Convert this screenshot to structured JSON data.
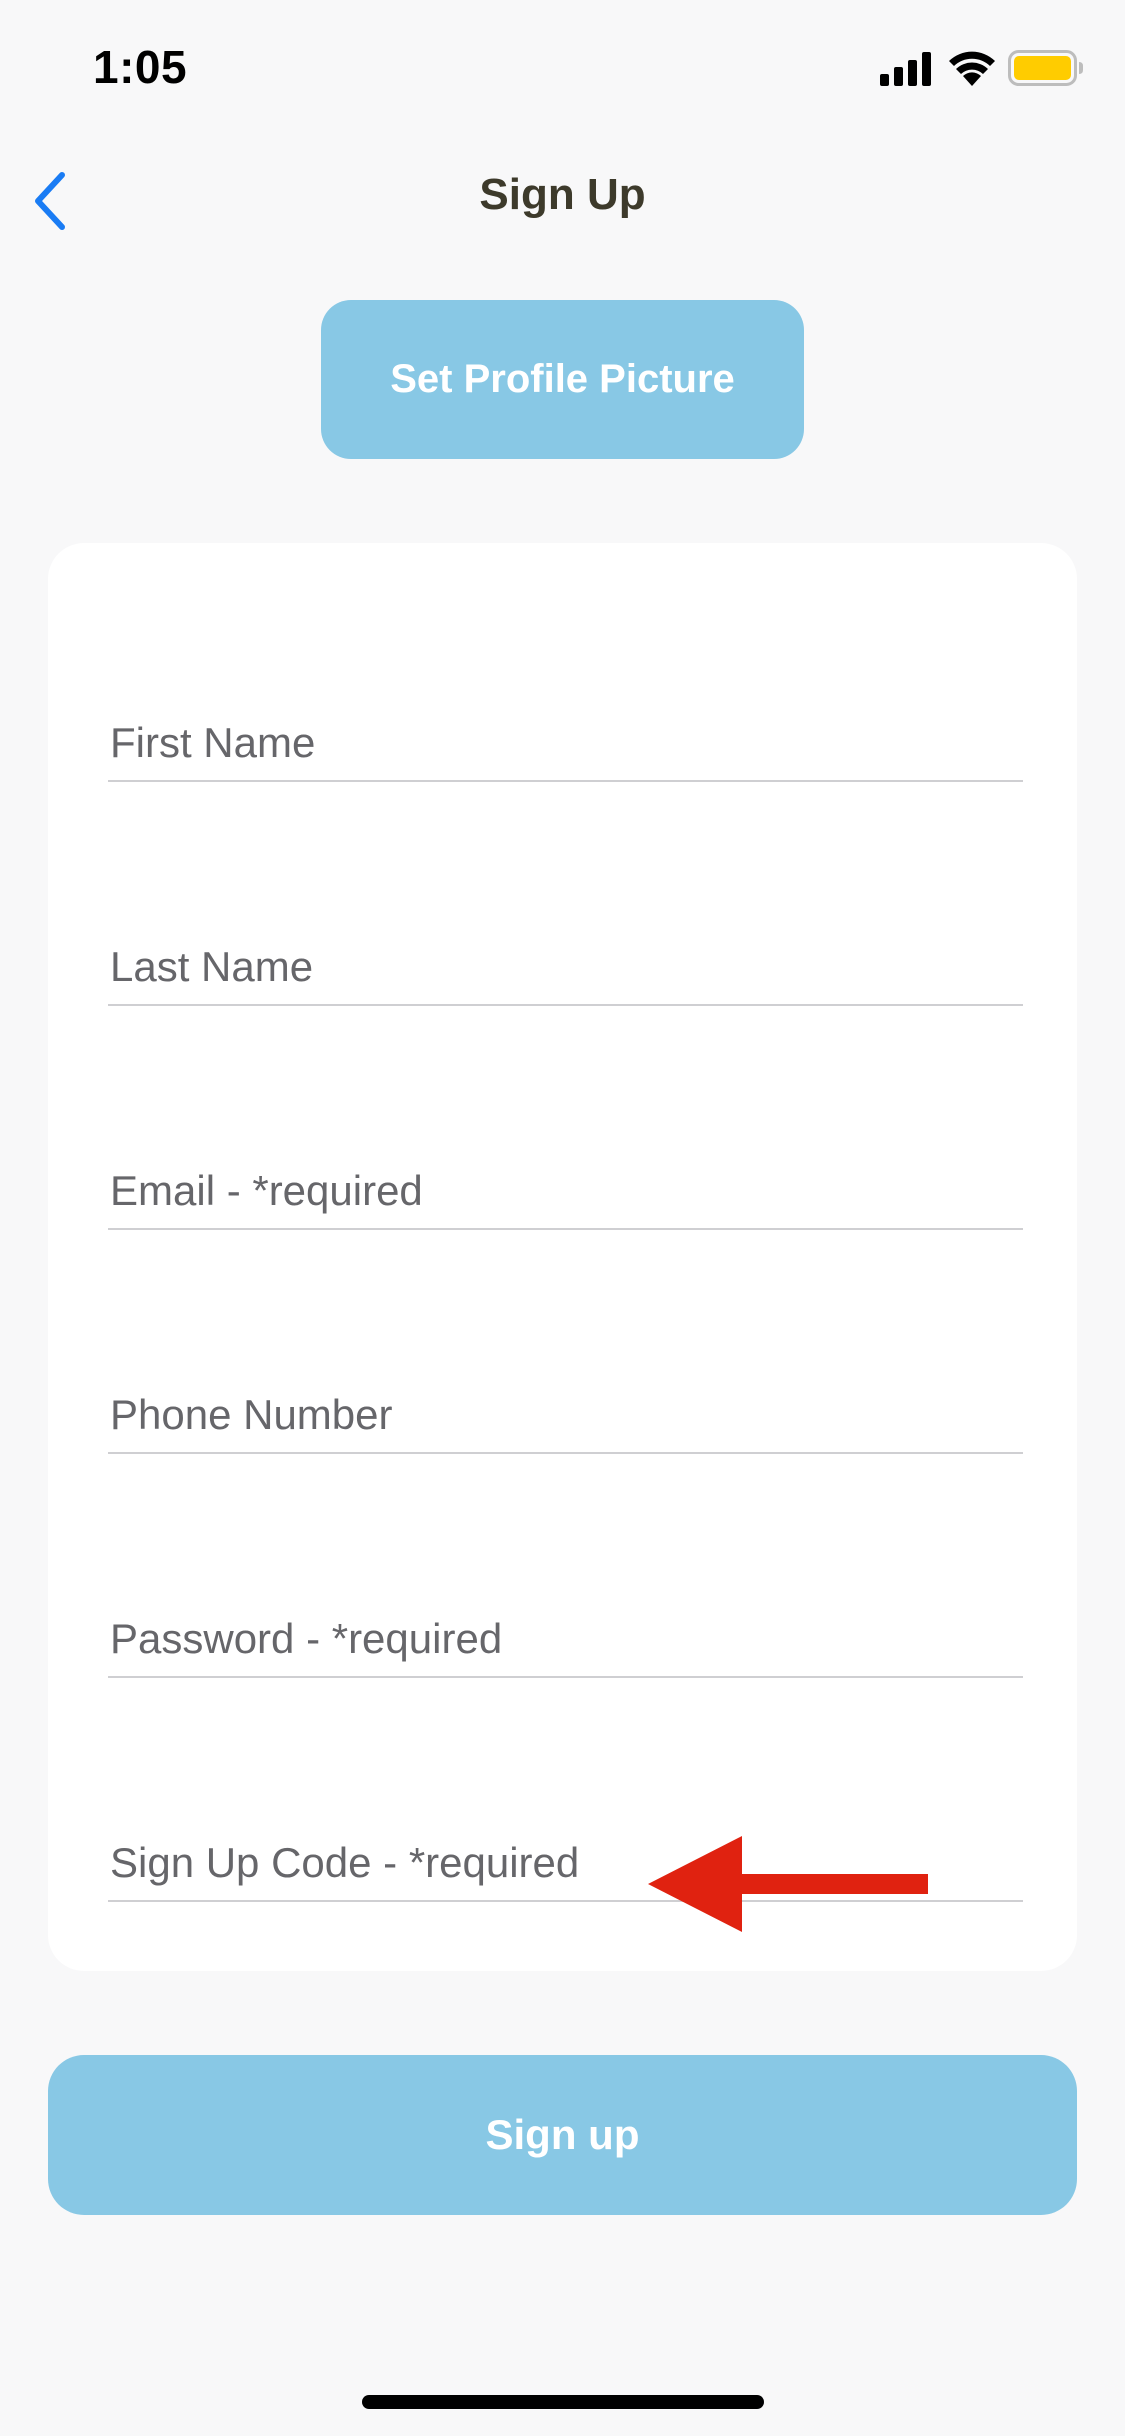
{
  "status_bar": {
    "time": "1:05",
    "icons": [
      "signal-icon",
      "wifi-icon",
      "battery-icon"
    ],
    "battery_color": "#FFCC00"
  },
  "nav": {
    "title": "Sign Up",
    "back_icon": "chevron-left-icon",
    "back_color": "#1A7CF4"
  },
  "profile": {
    "button_label": "Set Profile Picture"
  },
  "form": {
    "fields": [
      {
        "placeholder": "First Name",
        "value": ""
      },
      {
        "placeholder": "Last Name",
        "value": ""
      },
      {
        "placeholder": "Email - *required",
        "value": ""
      },
      {
        "placeholder": "Phone Number",
        "value": ""
      },
      {
        "placeholder": "Password - *required",
        "value": ""
      },
      {
        "placeholder": "Sign Up Code - *required",
        "value": ""
      }
    ]
  },
  "annotation": {
    "icon": "arrow-left-icon",
    "color": "#E02210"
  },
  "actions": {
    "signup_label": "Sign up"
  },
  "colors": {
    "accent": "#88C8E5",
    "background": "#F8F8F9"
  }
}
